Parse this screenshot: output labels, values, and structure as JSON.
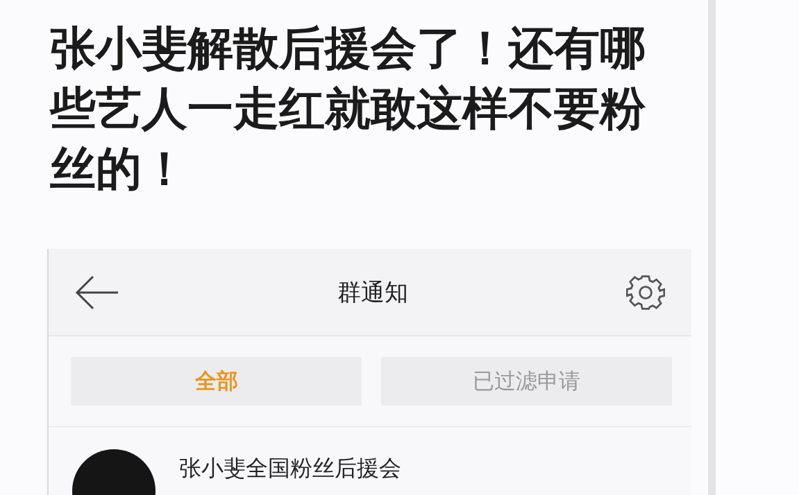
{
  "headline": "张小斐解散后援会了！还有哪些艺人一走红就敢这样不要粉丝的！",
  "screenshot": {
    "title": "群通知",
    "tabs": [
      {
        "label": "全部",
        "selected": true
      },
      {
        "label": "已过滤申请",
        "selected": false
      }
    ],
    "notifications": [
      {
        "name": "张小斐全国粉丝后援会"
      }
    ]
  }
}
